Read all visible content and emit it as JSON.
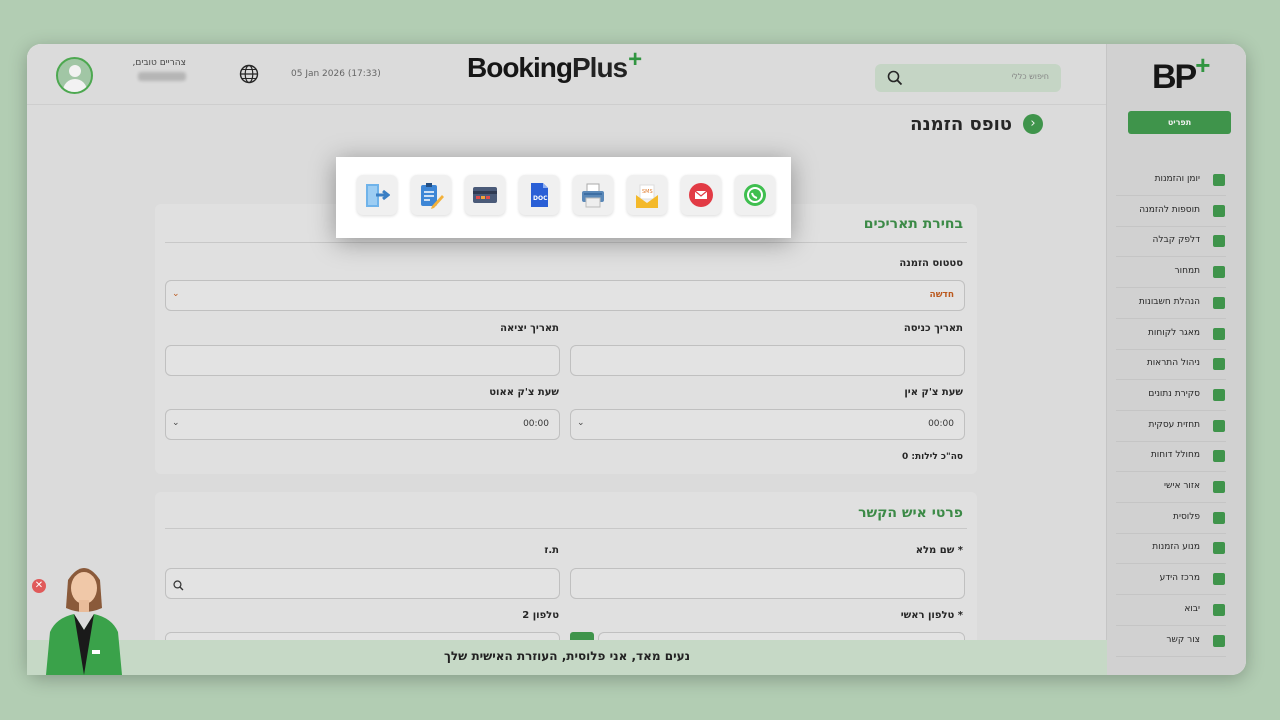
{
  "header": {
    "greeting": "צהריים טובים,",
    "datetime": "05 Jan 2026 (17:33)",
    "logo_main": "Booking",
    "logo_plus": "Plus",
    "search_placeholder": "חיפוש כללי"
  },
  "page": {
    "title": "טופס הזמנה"
  },
  "share_popup": {
    "buttons": [
      "whatsapp-icon",
      "email-icon",
      "sms-icon",
      "print-icon",
      "doc-icon",
      "credit-card-icon",
      "edit-clipboard-icon",
      "exit-icon"
    ]
  },
  "dates_section": {
    "title": "בחירת תאריכים",
    "status_label": "סטטוס הזמנה",
    "status_value": "חדשה",
    "checkin_label": "תאריך כניסה",
    "checkout_label": "תאריך יציאה",
    "checkin_time_label": "שעת צ'ק אין",
    "checkout_time_label": "שעת צ'ק אאוט",
    "checkin_time_value": "00:00",
    "checkout_time_value": "00:00",
    "nights_text": "סה\"כ לילות: 0"
  },
  "contact_section": {
    "title": "פרטי איש הקשר",
    "fullname_label": "* שם מלא",
    "id_label": "ת.ז",
    "phone_label": "* טלפון ראשי",
    "phone2_label": "טלפון 2"
  },
  "sidebar": {
    "logo": "BP",
    "logo_plus": "+",
    "menu_button": "תפריט",
    "items": [
      {
        "label": "יומן והזמנות"
      },
      {
        "label": "תוספות להזמנה"
      },
      {
        "label": "דלפק קבלה"
      },
      {
        "label": "תמחור"
      },
      {
        "label": "הנהלת חשבונות"
      },
      {
        "label": "מאגר לקוחות"
      },
      {
        "label": "ניהול התראות"
      },
      {
        "label": "סקירת נתונים"
      },
      {
        "label": "תחזית עסקית"
      },
      {
        "label": "מחולל דוחות"
      },
      {
        "label": "אזור אישי"
      },
      {
        "label": "פלוסית"
      },
      {
        "label": "מנוע הזמנות"
      },
      {
        "label": "מרכז הידע"
      },
      {
        "label": "יבוא"
      },
      {
        "label": "צור קשר"
      }
    ]
  },
  "assistant": {
    "message": "נעים מאד, אני פלוסית, העוזרת האישית שלך"
  },
  "colors": {
    "brand_green": "#3d9a4a",
    "status_orange": "#c45a1a"
  }
}
